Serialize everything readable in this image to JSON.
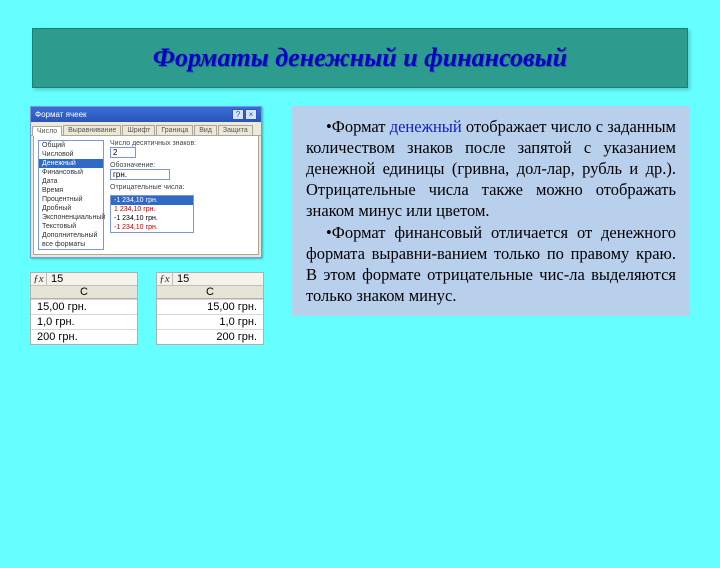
{
  "title": "Форматы денежный и финансовый",
  "dialog": {
    "title": "Формат ячеек",
    "help_btn": "?",
    "close_btn": "×",
    "tabs": [
      "Число",
      "Выравнивание",
      "Шрифт",
      "Граница",
      "Вид",
      "Защита"
    ],
    "categories": [
      "Общий",
      "Числовой",
      "Денежный",
      "Финансовый",
      "Дата",
      "Время",
      "Процентный",
      "Дробный",
      "Экспоненциальный",
      "Текстовый",
      "Дополнительный",
      "все форматы"
    ],
    "selected_category_index": 2,
    "decimal_label": "Число десятичных знаков:",
    "decimal_value": "2",
    "currency_label": "Обозначение:",
    "currency_value": "грн.",
    "neg_label": "Отрицательные числа:",
    "samples": [
      "-1 234,10 грн.",
      "1 234,10 грн.",
      "-1 234,10 грн.",
      "-1 234,10 грн."
    ]
  },
  "fx_value": "15",
  "col_header": "C",
  "table_left": [
    "15,00 грн.",
    "1,0 грн.",
    "200 грн."
  ],
  "table_right": [
    "15,00 грн.",
    "1,0 грн.",
    "200 грн."
  ],
  "para": {
    "bullet": "•",
    "p1_lead": "Формат ",
    "p1_kw": "денежный",
    "p1_rest": " отображает число с заданным количеством знаков после запятой с указанием денежной единицы (гривна, дол-лар, рубль и др.). Отрицательные числа также можно отображать знаком минус или цветом.",
    "p2": "Формат финансовый отличается от денежного формата выравни-ванием только по правому краю. В этом формате отрицательные чис-ла выделяются только знаком минус."
  }
}
